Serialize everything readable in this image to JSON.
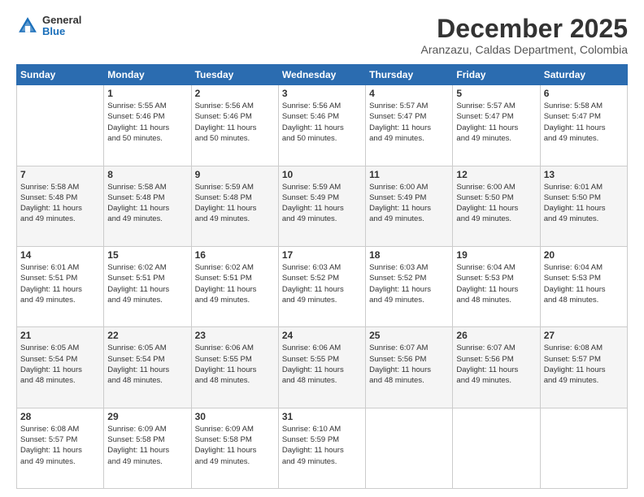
{
  "logo": {
    "general": "General",
    "blue": "Blue"
  },
  "title": "December 2025",
  "subtitle": "Aranzazu, Caldas Department, Colombia",
  "header_days": [
    "Sunday",
    "Monday",
    "Tuesday",
    "Wednesday",
    "Thursday",
    "Friday",
    "Saturday"
  ],
  "weeks": [
    [
      {
        "day": "",
        "info": ""
      },
      {
        "day": "1",
        "info": "Sunrise: 5:55 AM\nSunset: 5:46 PM\nDaylight: 11 hours\nand 50 minutes."
      },
      {
        "day": "2",
        "info": "Sunrise: 5:56 AM\nSunset: 5:46 PM\nDaylight: 11 hours\nand 50 minutes."
      },
      {
        "day": "3",
        "info": "Sunrise: 5:56 AM\nSunset: 5:46 PM\nDaylight: 11 hours\nand 50 minutes."
      },
      {
        "day": "4",
        "info": "Sunrise: 5:57 AM\nSunset: 5:47 PM\nDaylight: 11 hours\nand 49 minutes."
      },
      {
        "day": "5",
        "info": "Sunrise: 5:57 AM\nSunset: 5:47 PM\nDaylight: 11 hours\nand 49 minutes."
      },
      {
        "day": "6",
        "info": "Sunrise: 5:58 AM\nSunset: 5:47 PM\nDaylight: 11 hours\nand 49 minutes."
      }
    ],
    [
      {
        "day": "7",
        "info": "Sunrise: 5:58 AM\nSunset: 5:48 PM\nDaylight: 11 hours\nand 49 minutes."
      },
      {
        "day": "8",
        "info": "Sunrise: 5:58 AM\nSunset: 5:48 PM\nDaylight: 11 hours\nand 49 minutes."
      },
      {
        "day": "9",
        "info": "Sunrise: 5:59 AM\nSunset: 5:48 PM\nDaylight: 11 hours\nand 49 minutes."
      },
      {
        "day": "10",
        "info": "Sunrise: 5:59 AM\nSunset: 5:49 PM\nDaylight: 11 hours\nand 49 minutes."
      },
      {
        "day": "11",
        "info": "Sunrise: 6:00 AM\nSunset: 5:49 PM\nDaylight: 11 hours\nand 49 minutes."
      },
      {
        "day": "12",
        "info": "Sunrise: 6:00 AM\nSunset: 5:50 PM\nDaylight: 11 hours\nand 49 minutes."
      },
      {
        "day": "13",
        "info": "Sunrise: 6:01 AM\nSunset: 5:50 PM\nDaylight: 11 hours\nand 49 minutes."
      }
    ],
    [
      {
        "day": "14",
        "info": "Sunrise: 6:01 AM\nSunset: 5:51 PM\nDaylight: 11 hours\nand 49 minutes."
      },
      {
        "day": "15",
        "info": "Sunrise: 6:02 AM\nSunset: 5:51 PM\nDaylight: 11 hours\nand 49 minutes."
      },
      {
        "day": "16",
        "info": "Sunrise: 6:02 AM\nSunset: 5:51 PM\nDaylight: 11 hours\nand 49 minutes."
      },
      {
        "day": "17",
        "info": "Sunrise: 6:03 AM\nSunset: 5:52 PM\nDaylight: 11 hours\nand 49 minutes."
      },
      {
        "day": "18",
        "info": "Sunrise: 6:03 AM\nSunset: 5:52 PM\nDaylight: 11 hours\nand 49 minutes."
      },
      {
        "day": "19",
        "info": "Sunrise: 6:04 AM\nSunset: 5:53 PM\nDaylight: 11 hours\nand 48 minutes."
      },
      {
        "day": "20",
        "info": "Sunrise: 6:04 AM\nSunset: 5:53 PM\nDaylight: 11 hours\nand 48 minutes."
      }
    ],
    [
      {
        "day": "21",
        "info": "Sunrise: 6:05 AM\nSunset: 5:54 PM\nDaylight: 11 hours\nand 48 minutes."
      },
      {
        "day": "22",
        "info": "Sunrise: 6:05 AM\nSunset: 5:54 PM\nDaylight: 11 hours\nand 48 minutes."
      },
      {
        "day": "23",
        "info": "Sunrise: 6:06 AM\nSunset: 5:55 PM\nDaylight: 11 hours\nand 48 minutes."
      },
      {
        "day": "24",
        "info": "Sunrise: 6:06 AM\nSunset: 5:55 PM\nDaylight: 11 hours\nand 48 minutes."
      },
      {
        "day": "25",
        "info": "Sunrise: 6:07 AM\nSunset: 5:56 PM\nDaylight: 11 hours\nand 48 minutes."
      },
      {
        "day": "26",
        "info": "Sunrise: 6:07 AM\nSunset: 5:56 PM\nDaylight: 11 hours\nand 49 minutes."
      },
      {
        "day": "27",
        "info": "Sunrise: 6:08 AM\nSunset: 5:57 PM\nDaylight: 11 hours\nand 49 minutes."
      }
    ],
    [
      {
        "day": "28",
        "info": "Sunrise: 6:08 AM\nSunset: 5:57 PM\nDaylight: 11 hours\nand 49 minutes."
      },
      {
        "day": "29",
        "info": "Sunrise: 6:09 AM\nSunset: 5:58 PM\nDaylight: 11 hours\nand 49 minutes."
      },
      {
        "day": "30",
        "info": "Sunrise: 6:09 AM\nSunset: 5:58 PM\nDaylight: 11 hours\nand 49 minutes."
      },
      {
        "day": "31",
        "info": "Sunrise: 6:10 AM\nSunset: 5:59 PM\nDaylight: 11 hours\nand 49 minutes."
      },
      {
        "day": "",
        "info": ""
      },
      {
        "day": "",
        "info": ""
      },
      {
        "day": "",
        "info": ""
      }
    ]
  ]
}
